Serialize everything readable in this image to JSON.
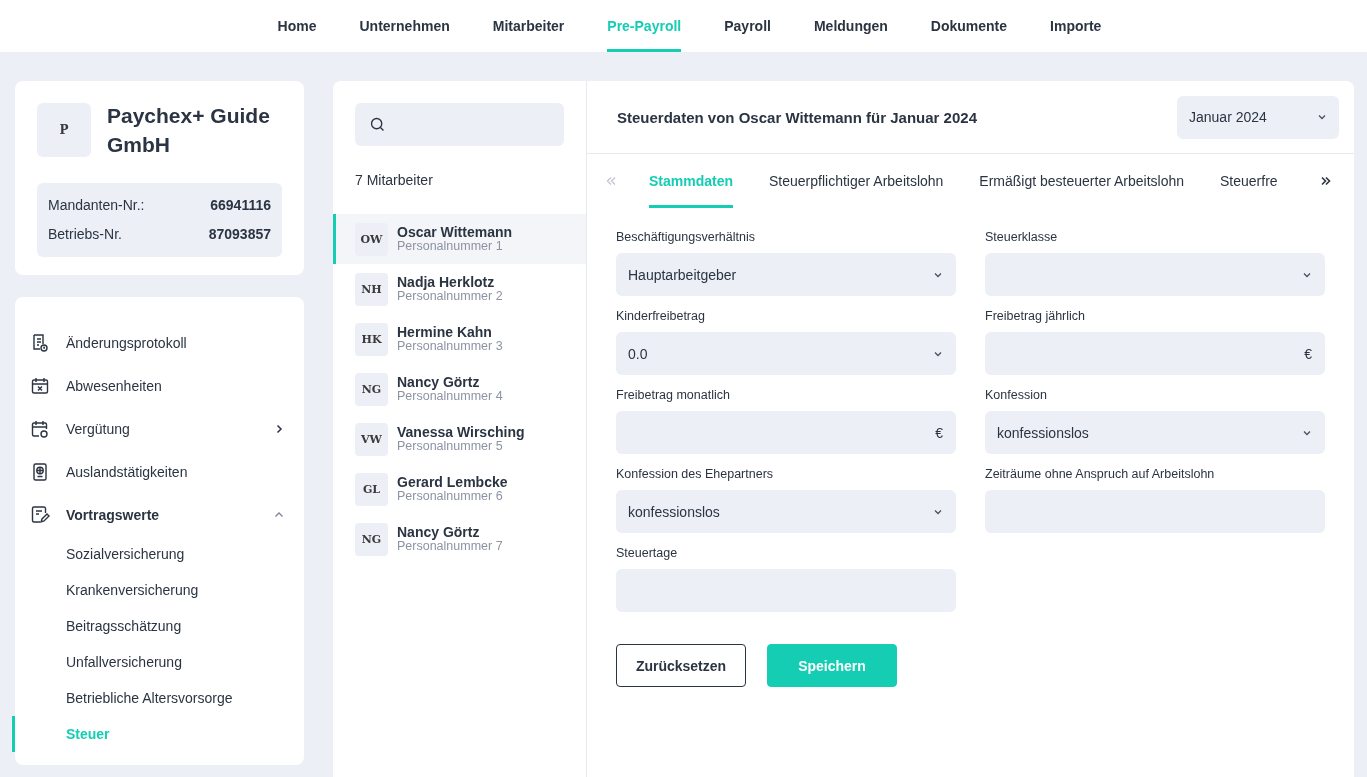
{
  "nav": [
    {
      "label": "Home",
      "selected": false
    },
    {
      "label": "Unternehmen",
      "selected": false
    },
    {
      "label": "Mitarbeiter",
      "selected": false
    },
    {
      "label": "Pre-Payroll",
      "selected": true
    },
    {
      "label": "Payroll",
      "selected": false
    },
    {
      "label": "Meldungen",
      "selected": false
    },
    {
      "label": "Dokumente",
      "selected": false
    },
    {
      "label": "Importe",
      "selected": false
    }
  ],
  "company": {
    "logo": "P",
    "name": "Paychex+ Guide GmbH",
    "ids": [
      {
        "label": "Mandanten-Nr.:",
        "value": "66941116"
      },
      {
        "label": "Betriebs-Nr.",
        "value": "87093857"
      }
    ]
  },
  "sidebar": {
    "items": [
      {
        "label": "Änderungsprotokoll",
        "selected": false
      },
      {
        "label": "Abwesenheiten",
        "selected": false
      },
      {
        "label": "Vergütung",
        "selected": false,
        "expanded": false
      },
      {
        "label": "Auslandstätigkeiten",
        "selected": false
      },
      {
        "label": "Vortragswerte",
        "selected": false,
        "expanded": true,
        "children": [
          {
            "label": "Sozialversicherung",
            "selected": false
          },
          {
            "label": "Krankenversicherung",
            "selected": false
          },
          {
            "label": "Beitragsschätzung",
            "selected": false
          },
          {
            "label": "Unfallversicherung",
            "selected": false
          },
          {
            "label": "Betriebliche Altersvorsorge",
            "selected": false
          },
          {
            "label": "Steuer",
            "selected": true
          }
        ]
      }
    ]
  },
  "employees": {
    "count": "7 Mitarbeiter",
    "items": [
      {
        "initials": "OW",
        "name": "Oscar Wittemann",
        "number": "Personalnummer 1",
        "selected": true
      },
      {
        "initials": "NH",
        "name": "Nadja Herklotz",
        "number": "Personalnummer 2",
        "selected": false
      },
      {
        "initials": "HK",
        "name": "Hermine Kahn",
        "number": "Personalnummer 3",
        "selected": false
      },
      {
        "initials": "NG",
        "name": "Nancy Görtz",
        "number": "Personalnummer 4",
        "selected": false
      },
      {
        "initials": "VW",
        "name": "Vanessa Wirsching",
        "number": "Personalnummer 5",
        "selected": false
      },
      {
        "initials": "GL",
        "name": "Gerard Lembcke",
        "number": "Personalnummer 6",
        "selected": false
      },
      {
        "initials": "NG",
        "name": "Nancy Görtz",
        "number": "Personalnummer 7",
        "selected": false
      }
    ]
  },
  "detail": {
    "title": "Steuerdaten von Oscar Wittemann für Januar 2024",
    "period": "Januar 2024",
    "tabs": [
      {
        "label": "Stammdaten",
        "selected": true
      },
      {
        "label": "Steuerpflichtiger Arbeitslohn",
        "selected": false
      },
      {
        "label": "Ermäßigt besteuerter Arbeitslohn",
        "selected": false
      },
      {
        "label": "Steuerfre",
        "selected": false
      }
    ],
    "tabs_prev_disabled": true,
    "fields": [
      {
        "kind": "select",
        "label": "Beschäftigungsverhältnis",
        "value": "Hauptarbeitgeber"
      },
      {
        "kind": "select",
        "label": "Steuerklasse"
      },
      {
        "kind": "select",
        "label": "Kinderfreibetrag",
        "value": "0.0"
      },
      {
        "kind": "currency",
        "label": "Freibetrag jährlich",
        "unit": "€"
      },
      {
        "kind": "currency",
        "label": "Freibetrag monatlich",
        "unit": "€"
      },
      {
        "kind": "select",
        "label": "Konfession",
        "value": "konfessionslos"
      },
      {
        "kind": "select",
        "label": "Konfession des Ehepartners",
        "value": "konfessionslos"
      },
      {
        "kind": "text",
        "label": "Zeiträume ohne Anspruch auf Arbeitslohn"
      },
      {
        "kind": "text",
        "label": "Steuertage"
      }
    ],
    "buttons": [
      {
        "kind": "secondary",
        "label": "Zurücksetzen"
      },
      {
        "kind": "primary",
        "label": "Speichern"
      }
    ]
  }
}
